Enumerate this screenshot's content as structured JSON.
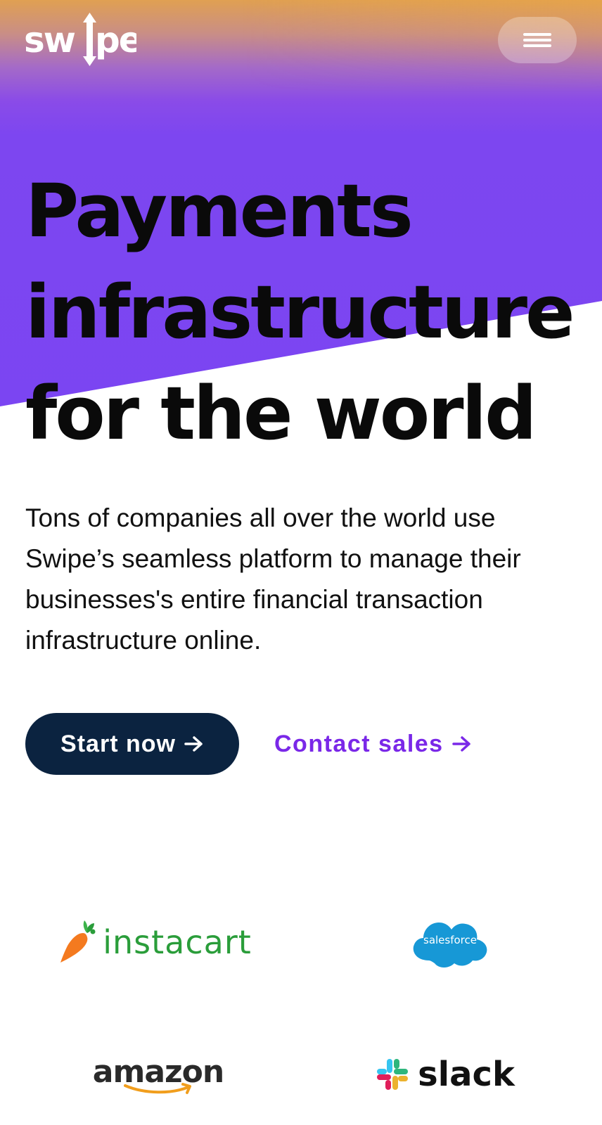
{
  "header": {
    "logo_text": "swipe",
    "menu_icon": "hamburger-icon"
  },
  "hero": {
    "headline_lines": [
      "Payments",
      "infrastructure",
      "for the world"
    ],
    "description": "Tons of companies all over the world use Swipe’s seamless platform to manage their businesses's entire financial transaction infrastructure online.",
    "start_label": "Start now",
    "contact_label": "Contact sales",
    "arrow_icon": "arrow-right-icon"
  },
  "customers": {
    "logos": [
      {
        "name": "instacart",
        "text": "instacart",
        "color": "#2a9d3a",
        "icon": "carrot-icon"
      },
      {
        "name": "salesforce",
        "text": "salesforce",
        "color": "#1798d6",
        "icon": "cloud-icon"
      },
      {
        "name": "amazon",
        "text": "amazon",
        "color": "#f19e1d",
        "icon": "amazon-smile-icon"
      },
      {
        "name": "slack",
        "text": "slack",
        "color": "#111111",
        "icon": "slack-hash-icon"
      }
    ]
  },
  "colors": {
    "gradient_top": "#e0a052",
    "gradient_purple": "#7b45f2",
    "start_button_bg": "#0b2340",
    "contact_link": "#7a28e8",
    "headline": "#0a0a0a"
  }
}
